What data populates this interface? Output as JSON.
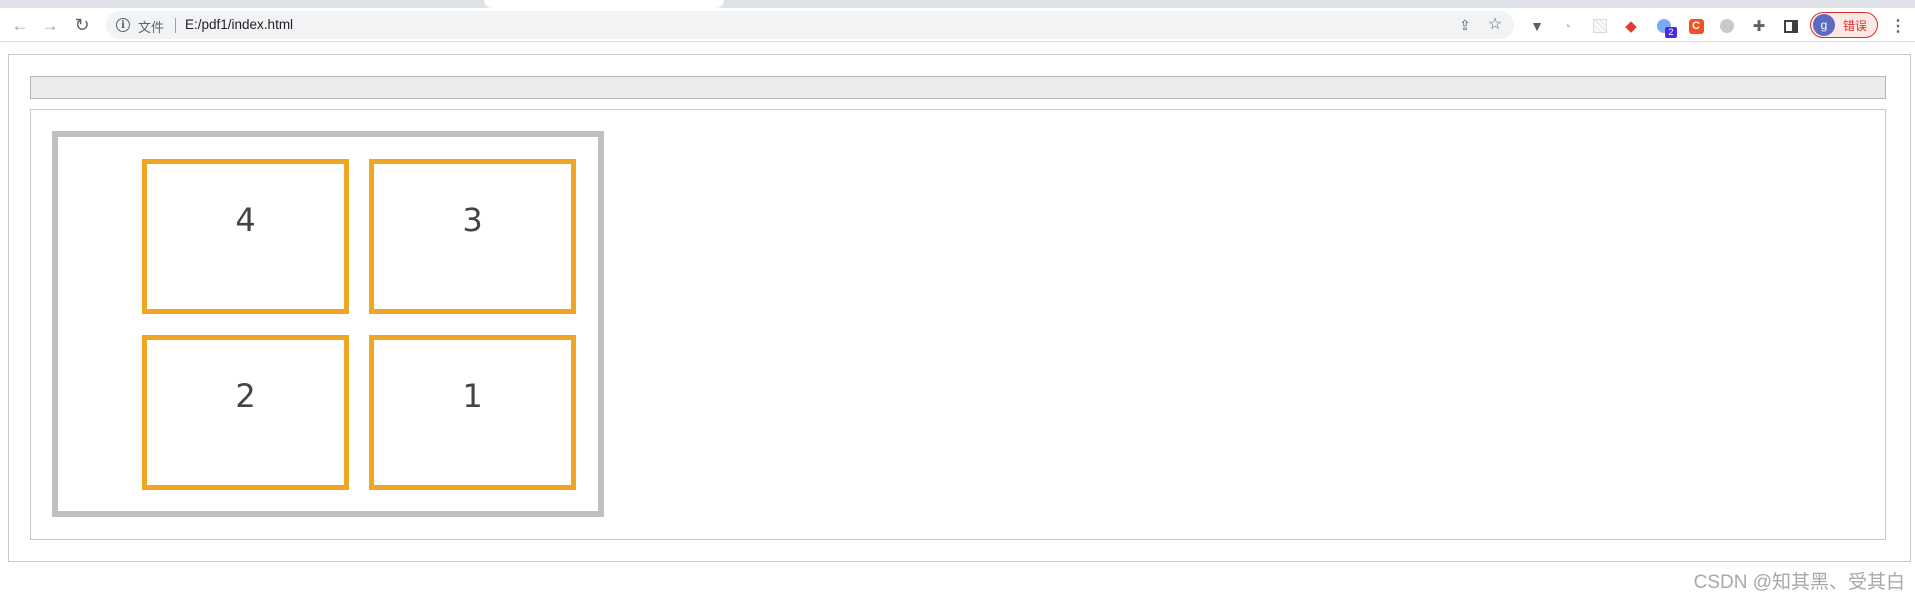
{
  "browser": {
    "nav": {
      "back_icon": "←",
      "forward_icon": "→",
      "reload_icon": "↻"
    },
    "omnibox": {
      "site_label": "文件",
      "url": "E:/pdf1/index.html",
      "info_icon": "i",
      "share_icon": "⇪",
      "star_icon": "☆"
    },
    "extensions": {
      "v_icon": "▼",
      "clock_icon": "◔",
      "cube_icon": "◆",
      "globe_badge": "2",
      "c_icon": "C",
      "puzzle_icon": "✚"
    },
    "profile": {
      "avatar_letter": "g",
      "label": "错误"
    },
    "menu_icon": "⋮"
  },
  "page": {
    "cells": [
      "4",
      "3",
      "2",
      "1"
    ]
  },
  "watermark": "CSDN @知其黑、受其白",
  "colors": {
    "cell_border": "#f0a523",
    "container_border": "#c0c0c0",
    "top_bar_bg": "#ebebeb",
    "profile_accent": "#d93025"
  }
}
